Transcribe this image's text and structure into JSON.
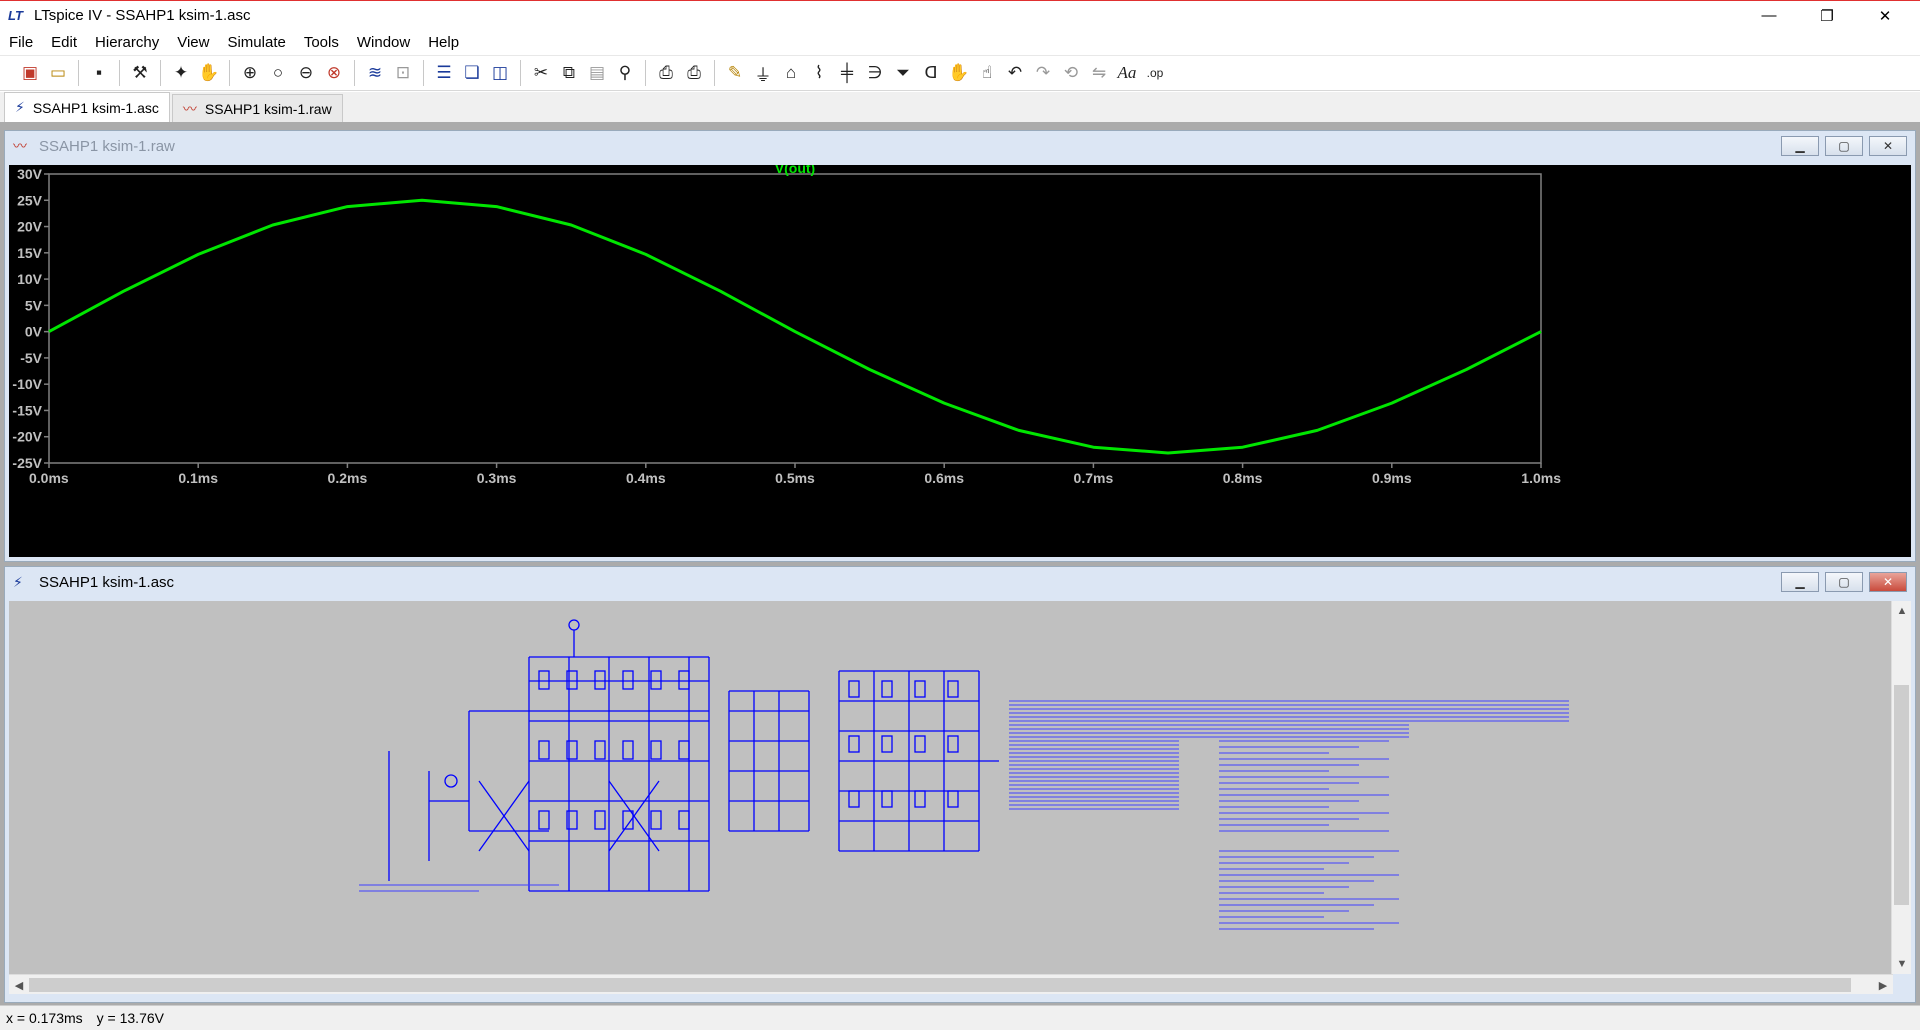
{
  "titlebar": {
    "title": "LTspice IV - SSAHP1 ksim-1.asc",
    "app_icon": "LT",
    "minimize": "—",
    "restore": "❐",
    "close": "✕"
  },
  "menus": [
    "File",
    "Edit",
    "Hierarchy",
    "View",
    "Simulate",
    "Tools",
    "Window",
    "Help"
  ],
  "toolbar": {
    "icons": [
      "new-schematic-icon",
      "open-icon",
      "save-icon",
      "control-panel-icon",
      "run-icon",
      "halt-icon",
      "zoom-in-icon",
      "zoom-area-icon",
      "zoom-out-icon",
      "zoom-cancel-icon",
      "autorange-icon",
      "fit-icon",
      "tile-horizontal-icon",
      "cascade-icon",
      "tile-vertical-icon",
      "cut-icon",
      "copy-icon",
      "paste-icon",
      "find-icon",
      "print-preview-icon",
      "print-icon",
      "draw-wire-icon",
      "ground-icon",
      "label-net-icon",
      "resistor-icon",
      "capacitor-icon",
      "inductor-icon",
      "diode-icon",
      "component-icon",
      "move-icon",
      "drag-icon",
      "undo-icon",
      "redo-icon",
      "rotate-icon",
      "mirror-icon",
      "text-icon",
      "spice-directive-icon"
    ]
  },
  "tabs": [
    {
      "label": "SSAHP1 ksim-1.asc",
      "icon": "schematic-icon"
    },
    {
      "label": "SSAHP1 ksim-1.raw",
      "icon": "waveform-icon"
    }
  ],
  "waveform_window": {
    "title": "SSAHP1 ksim-1.raw",
    "trace_label": "V(out)",
    "trace_color": "#00e600",
    "grid_color": "#808080",
    "tick_color": "#c0c0c0"
  },
  "schematic_window": {
    "title": "SSAHP1 ksim-1.asc",
    "wire_color": "#0000ff",
    "background": "#c0c0c0"
  },
  "chart_data": {
    "type": "line",
    "title": "",
    "xlabel": "",
    "ylabel": "",
    "xlim": [
      0,
      1.0
    ],
    "ylim": [
      -25,
      30
    ],
    "x_ticks": [
      "0.0ms",
      "0.1ms",
      "0.2ms",
      "0.3ms",
      "0.4ms",
      "0.5ms",
      "0.6ms",
      "0.7ms",
      "0.8ms",
      "0.9ms",
      "1.0ms"
    ],
    "y_ticks": [
      "30V",
      "25V",
      "20V",
      "15V",
      "10V",
      "5V",
      "0V",
      "-5V",
      "-10V",
      "-15V",
      "-20V",
      "-25V"
    ],
    "series": [
      {
        "name": "V(out)",
        "x": [
          0,
          0.05,
          0.1,
          0.15,
          0.2,
          0.25,
          0.3,
          0.35,
          0.4,
          0.45,
          0.5,
          0.55,
          0.6,
          0.65,
          0.7,
          0.75,
          0.8,
          0.85,
          0.9,
          0.95,
          1.0
        ],
        "y": [
          0,
          7.7,
          14.7,
          20.3,
          23.8,
          25.0,
          23.8,
          20.3,
          14.7,
          7.7,
          0,
          -7.2,
          -13.6,
          -18.8,
          -22.0,
          -23.1,
          -22.0,
          -18.8,
          -13.6,
          -7.2,
          0
        ]
      }
    ]
  },
  "status": {
    "x_readout": "x = 0.173ms",
    "y_readout": "y = 13.76V"
  }
}
